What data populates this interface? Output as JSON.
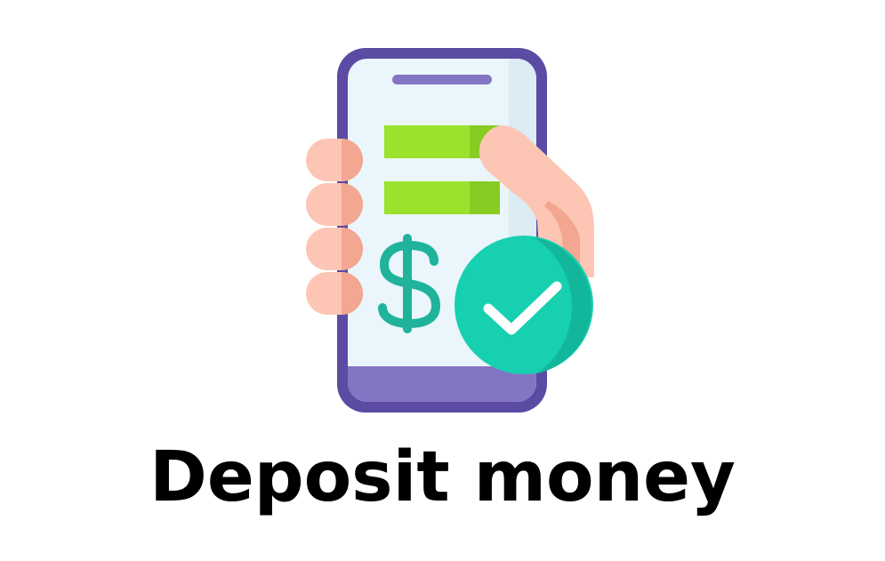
{
  "caption": "Deposit money",
  "icon": "phone-payment-approved-icon",
  "colors": {
    "frame": "#5b4ba3",
    "screen": "#eaf6fb",
    "bottom_bezel": "#8474c4",
    "speaker": "#8474c4",
    "bar_green": "#9be22d",
    "bar_green_dark": "#87cc22",
    "skin": "#fdc6b4",
    "skin_shade": "#f3a690",
    "dollar": "#1fb39b",
    "check_circle": "#17d0b0",
    "check_circle_dark": "#12b79b",
    "check_mark": "#ffffff",
    "caption_text": "#000000"
  }
}
